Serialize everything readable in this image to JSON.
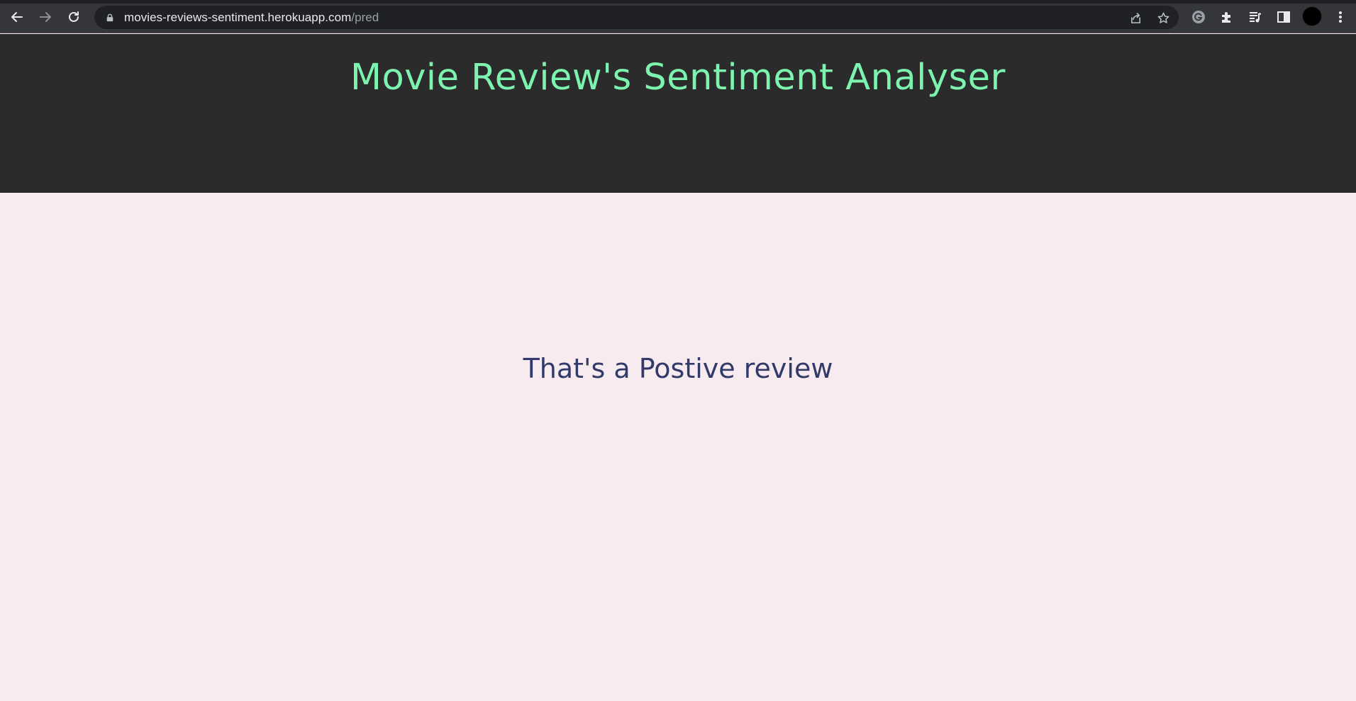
{
  "browser": {
    "url_host": "movies-reviews-sentiment.herokuapp.com",
    "url_path": "/pred",
    "icons": [
      "back-icon",
      "forward-icon",
      "reload-icon",
      "lock-icon",
      "share-icon",
      "star-icon",
      "grammarly-icon",
      "extensions-icon",
      "media-control-icon",
      "side-panel-icon",
      "profile-avatar",
      "menu-icon"
    ]
  },
  "header": {
    "title": "Movie Review's Sentiment Analyser"
  },
  "main": {
    "result": "That's a Postive review"
  },
  "colors": {
    "header_bg": "#2b2b2b",
    "title": "#7df3b0",
    "page_bg": "#f7ebf0",
    "result_text": "#313a69"
  }
}
